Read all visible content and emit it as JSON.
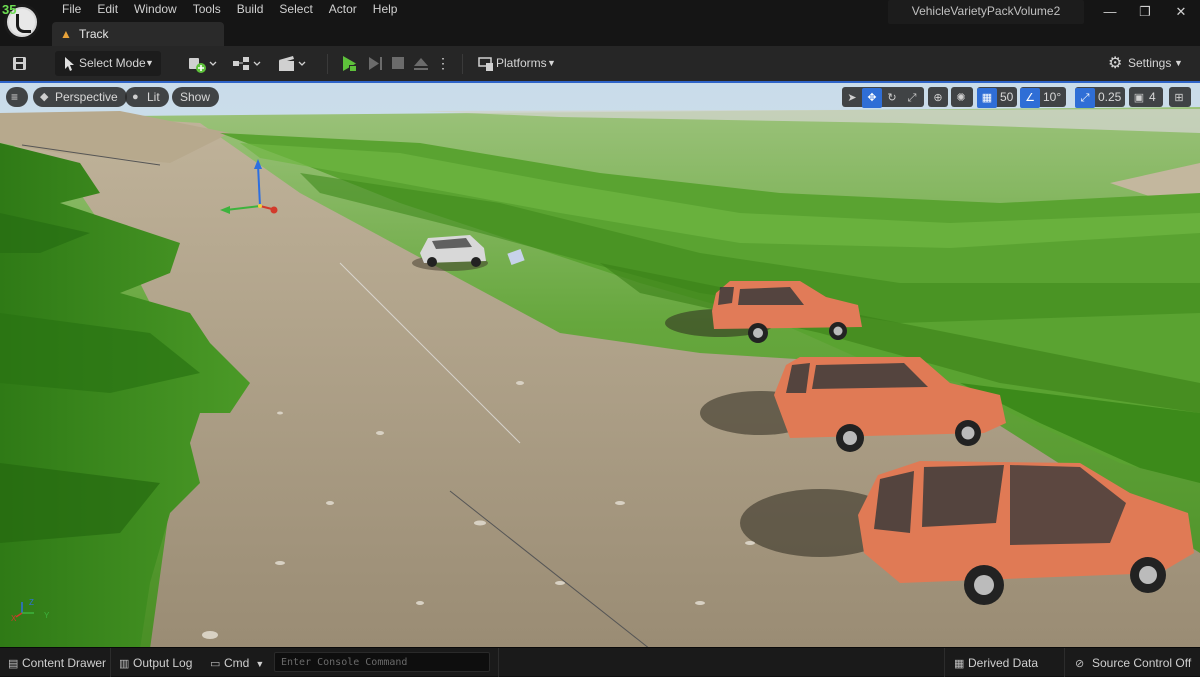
{
  "stats": {
    "fps": "35"
  },
  "menu": [
    "File",
    "Edit",
    "Window",
    "Tools",
    "Build",
    "Select",
    "Actor",
    "Help"
  ],
  "window": {
    "project_title": "VehicleVarietyPackVolume2",
    "minimize": "—",
    "maximize": "❐",
    "close": "✕"
  },
  "document_tab": {
    "label": "Track",
    "icon": "level-icon"
  },
  "toolbar": {
    "select_mode": "Select Mode",
    "platforms": "Platforms",
    "settings": "Settings"
  },
  "viewport": {
    "perspective": "Perspective",
    "lit": "Lit",
    "show": "Show",
    "grid_snap": "50",
    "rotation_snap": "10°",
    "scale_snap": "0.25",
    "camera_speed": "4"
  },
  "statusbar": {
    "content_drawer": "Content Drawer",
    "output_log": "Output Log",
    "cmd": "Cmd",
    "console_placeholder": "Enter Console Command",
    "derived_data": "Derived Data",
    "source_control": "Source Control Off"
  },
  "colors": {
    "accent": "#2f6ed6",
    "play_green": "#5ec13b",
    "level_icon": "#e8a33a",
    "suv": "#e07a55",
    "grass": "#4f9a2a",
    "dirt": "#a99a80"
  }
}
